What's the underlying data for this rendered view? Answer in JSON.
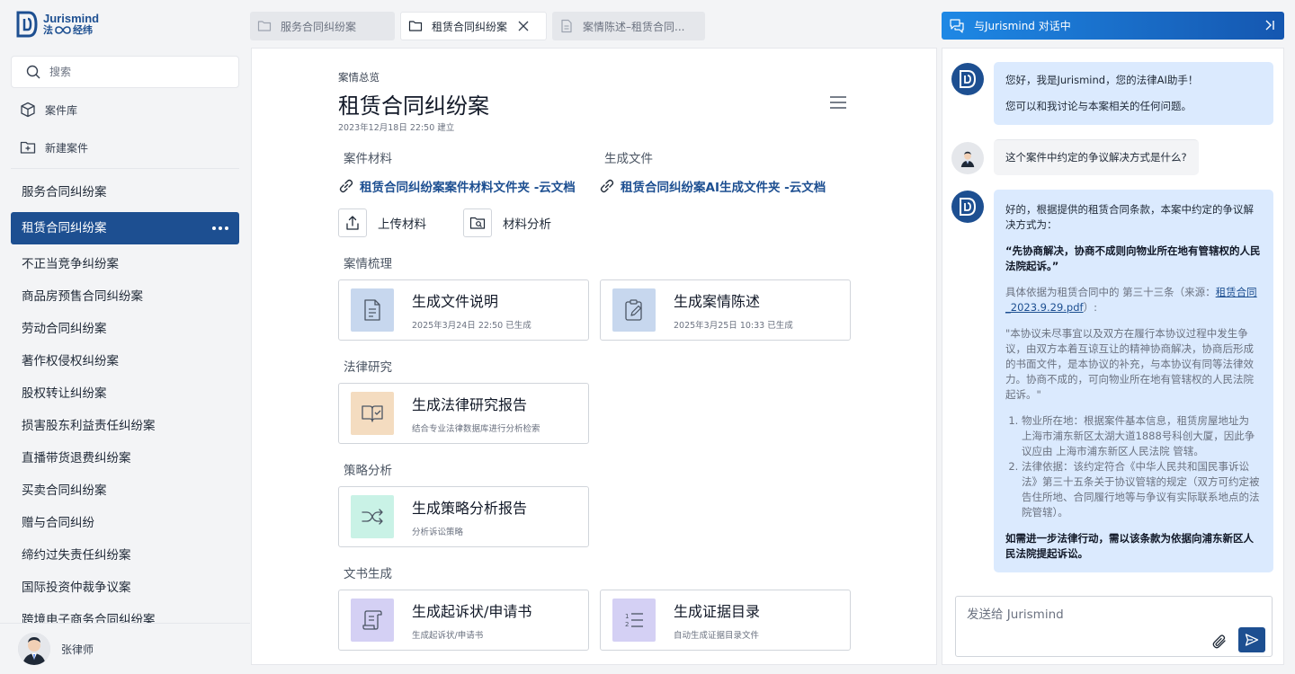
{
  "brand": {
    "name_en": "Jurismind",
    "name_cn": "法",
    "name_cn2": "经纬"
  },
  "sidebar": {
    "search_placeholder": "搜索",
    "library_label": "案件库",
    "new_case_label": "新建案件",
    "cases": [
      "服务合同纠纷案",
      "租赁合同纠纷案",
      "不正当竞争纠纷案",
      "商品房预售合同纠纷案",
      "劳动合同纠纷案",
      "著作权侵权纠纷案",
      "股权转让纠纷案",
      "损害股东利益责任纠纷案",
      "直播带货退费纠纷案",
      "买卖合同纠纷案",
      "赠与合同纠纷",
      "缔约过失责任纠纷案",
      "国际投资仲裁争议案",
      "跨境电子商务合同纠纷案"
    ],
    "user_name": "张律师"
  },
  "tabs": [
    {
      "label": "服务合同纠纷案",
      "icon": "folder-icon"
    },
    {
      "label": "租赁合同纠纷案",
      "icon": "folder-icon"
    },
    {
      "label": "案情陈述–租赁合同...",
      "icon": "document-icon"
    }
  ],
  "main": {
    "eyebrow": "案情总览",
    "title": "租赁合同纠纷案",
    "created": "2023年12月18日 22:50 建立",
    "sections": {
      "materials": "案件材料",
      "generated": "生成文件",
      "review": "案情梳理",
      "research": "法律研究",
      "strategy": "策略分析",
      "docs": "文书生成"
    },
    "links": {
      "materials_folder": "租赁合同纠纷案案件材料文件夹 -云文档",
      "ai_folder": "租赁合同纠纷案AI生成文件夹 -云文档"
    },
    "actions": {
      "upload": "上传材料",
      "analyze": "材料分析"
    },
    "cards": {
      "explain": {
        "title": "生成文件说明",
        "sub": "2025年3月24日 22:50 已生成",
        "color": "#c7d7ee"
      },
      "statement": {
        "title": "生成案情陈述",
        "sub": "2025年3月25日 10:33 已生成",
        "color": "#c7d7ee"
      },
      "research": {
        "title": "生成法律研究报告",
        "sub": "结合专业法律数据库进行分析检索",
        "color": "#f4dcc0"
      },
      "strategy": {
        "title": "生成策略分析报告",
        "sub": "分析诉讼策略",
        "color": "#c9f2e6"
      },
      "complaint": {
        "title": "生成起诉状/申请书",
        "sub": "生成起诉状/申请书",
        "color": "#d4d0f4"
      },
      "evidence": {
        "title": "生成证据目录",
        "sub": "自动生成证据目录文件",
        "color": "#d4d0f4"
      }
    }
  },
  "chat": {
    "header": "与Jurismind 对话中",
    "messages": {
      "greet1": "您好，我是Jurismind，您的法律AI助手！",
      "greet2": "您可以和我讨论与本案相关的任何问题。",
      "user_q": "这个案件中约定的争议解决方式是什么?",
      "ans_intro": "好的，根据提供的租赁合同条款，本案中约定的争议解决方式为：",
      "ans_quote": "“先协商解决，协商不成则向物业所在地有管辖权的人民法院起诉。”",
      "ans_basis_pre": "具体依据为租赁合同中的 第三十三条（来源：",
      "ans_basis_link": "租赁合同_2023.9.29.pdf",
      "ans_basis_post": "）:",
      "ans_clause": "\"本协议未尽事宜以及双方在履行本协议过程中发生争议，由双方本着互谅互让的精神协商解决，协商后形成的书面文件，是本协议的补充，与本协议有同等法律效力。协商不成的，可向物业所在地有管辖权的人民法院起诉。\"",
      "ans_point1": "物业所在地：根据案件基本信息，租赁房屋地址为 上海市浦东新区太湖大道1888号科创大厦，因此争议应由 上海市浦东新区人民法院 管辖。",
      "ans_point2": "法律依据：该约定符合《中华人民共和国民事诉讼法》第三十五条关于协议管辖的规定（双方可约定被告住所地、合同履行地等与争议有实际联系地点的法院管辖）。",
      "ans_conclusion": "如需进一步法律行动，需以该条款为依据向浦东新区人民法院提起诉讼。"
    },
    "input_placeholder": "发送给 Jurismind"
  }
}
